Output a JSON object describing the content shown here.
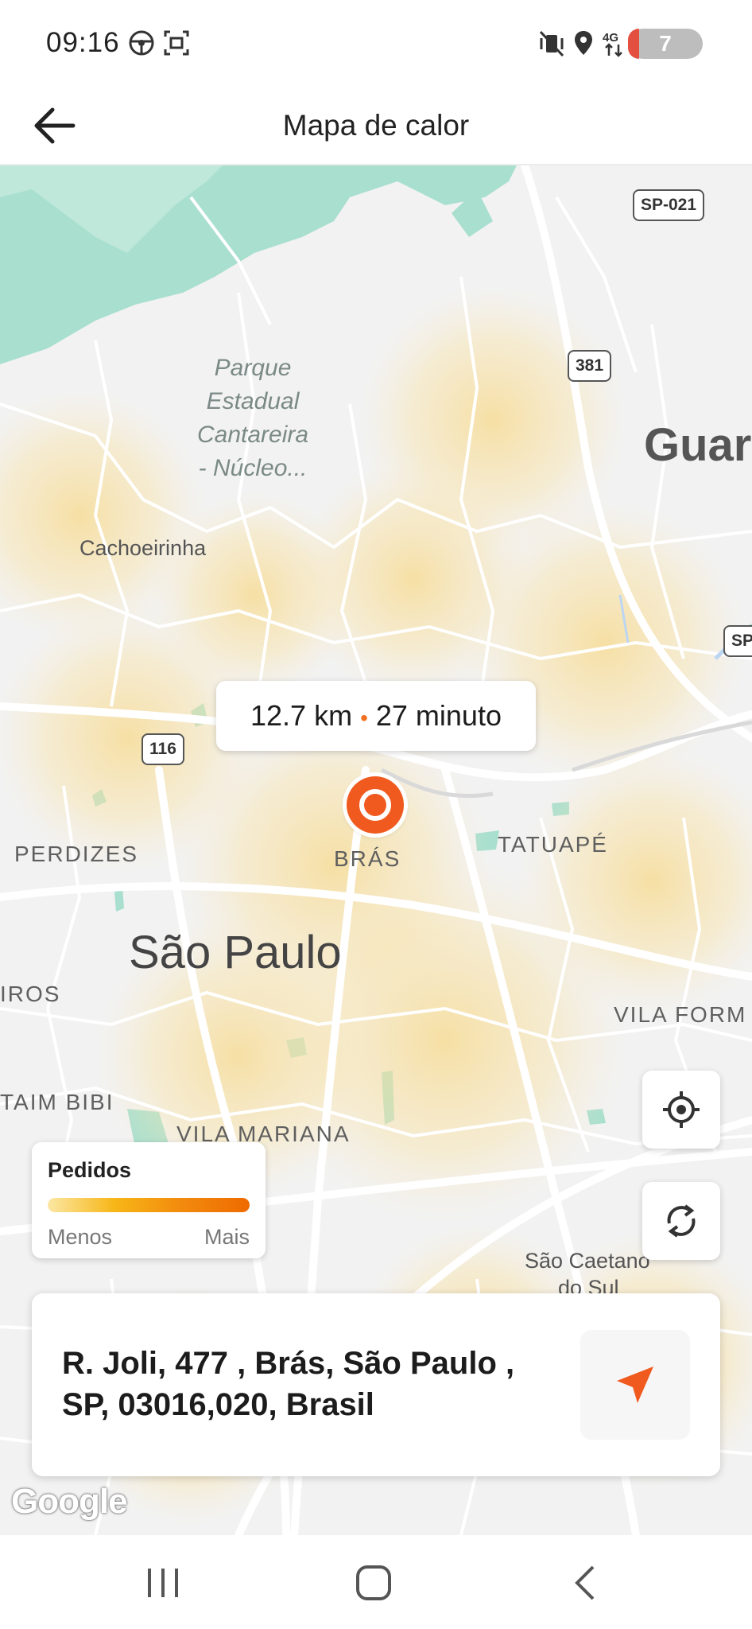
{
  "status_bar": {
    "time": "09:16",
    "left_icons": [
      "steering-wheel-icon",
      "screenshot-icon"
    ],
    "right_icons": [
      "mute-vibrate-icon",
      "location-icon",
      "4g-data-icon",
      "signal-icon"
    ],
    "notification_count": "7"
  },
  "app_bar": {
    "title": "Mapa de calor",
    "back_icon": "arrow-left-icon"
  },
  "map": {
    "labels": {
      "park": "Parque\nEstadual\nCantareira\n- Núcleo...",
      "cachoeirinha": "Cachoeirinha",
      "guarulhos_partial": "Guar",
      "perdizes": "PERDIZES",
      "bras": "BRÁS",
      "tatuape": "TATUAPÉ",
      "sao_paulo": "São Paulo",
      "iros_partial": "IROS",
      "vila_form_partial": "VILA FORM",
      "itaim_bibi_partial": "TAIM BIBI",
      "vila_mariana": "VILA MARIANA",
      "sao_caetano": "São Caetano",
      "do_sul": "do Sul"
    },
    "shields": {
      "sp021": "SP-021",
      "r381": "381",
      "r116": "116",
      "sp_partial": "SP"
    },
    "route_info": {
      "distance": "12.7 km",
      "separator": "•",
      "duration": "27 minuto"
    },
    "pin_icon": "location-target-pin-icon",
    "attribution": "Google"
  },
  "controls": {
    "locate_icon": "crosshair-locate-icon",
    "refresh_icon": "refresh-icon"
  },
  "legend": {
    "title": "Pedidos",
    "min_label": "Menos",
    "max_label": "Mais",
    "gradient_colors": [
      "#fbe7a3",
      "#f7b617",
      "#f28a0d",
      "#ee6a00"
    ]
  },
  "address": {
    "text": "R. Joli, 477 , Brás, São Paulo , SP, 03016,020, Brasil",
    "navigate_icon": "navigation-arrow-icon"
  },
  "system_nav": {
    "icons": [
      "recent-apps-icon",
      "home-icon",
      "back-icon"
    ]
  },
  "colors": {
    "accent": "#f05a1f",
    "park_green": "#a8dfce",
    "heat_yellow": "#f9dfa0"
  }
}
